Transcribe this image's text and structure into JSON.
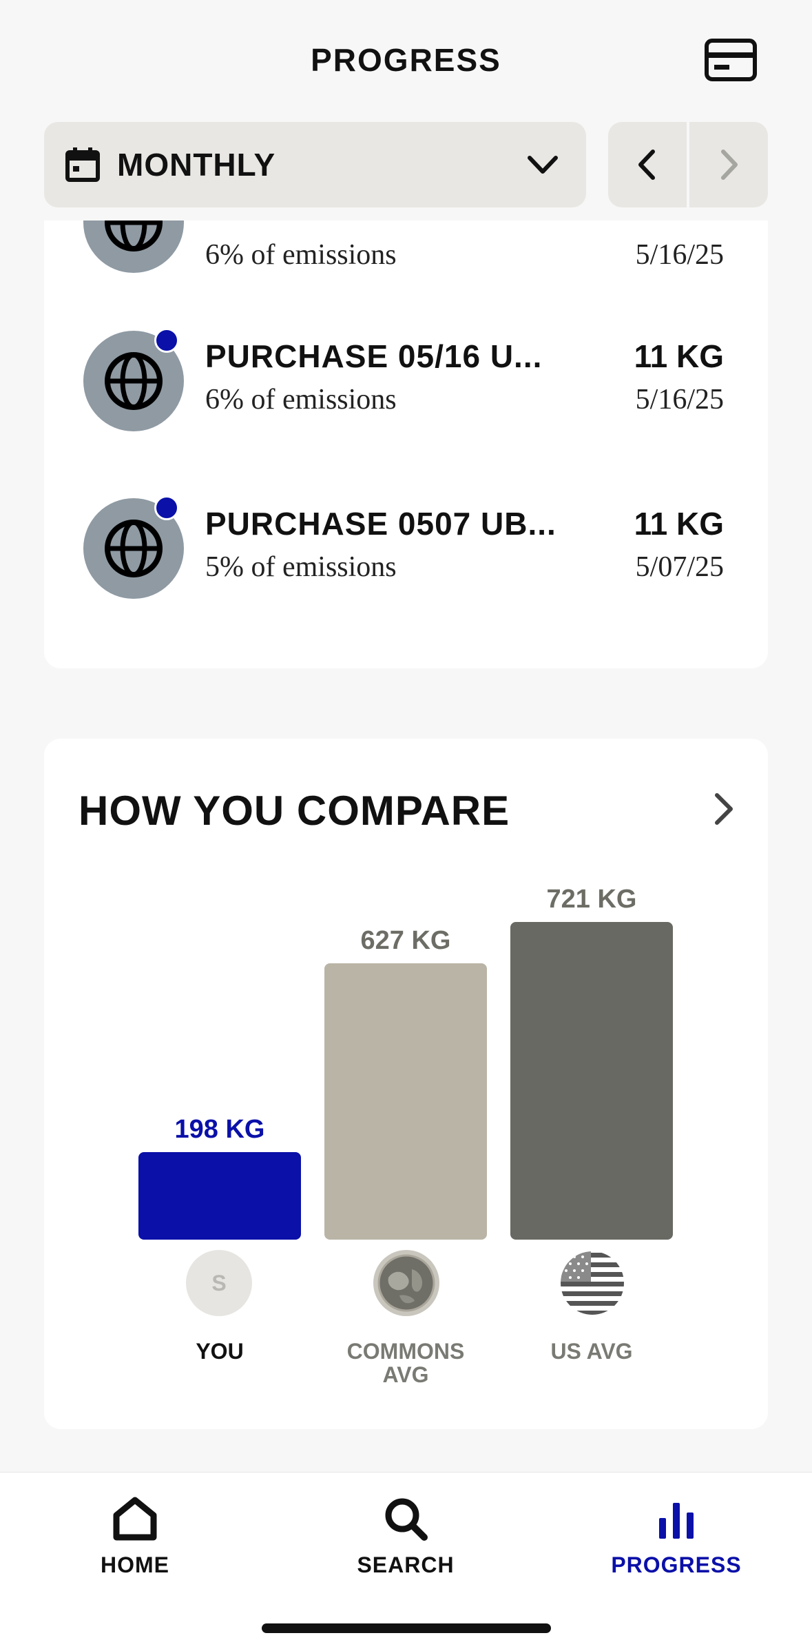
{
  "header": {
    "title": "PROGRESS"
  },
  "filter": {
    "period": "MONTHLY"
  },
  "transactions": [
    {
      "name": "",
      "pct": "6% of emissions",
      "amount": "",
      "date": "5/16/25"
    },
    {
      "name": "PURCHASE 05/16 U...",
      "pct": "6% of emissions",
      "amount": "11 KG",
      "date": "5/16/25"
    },
    {
      "name": "PURCHASE 0507 UB...",
      "pct": "5% of emissions",
      "amount": "11 KG",
      "date": "5/07/25"
    }
  ],
  "compare": {
    "title": "HOW YOU COMPARE",
    "you_initial": "S"
  },
  "chart_data": {
    "type": "bar",
    "categories": [
      "YOU",
      "COMMONS AVG",
      "US AVG"
    ],
    "values": [
      198,
      627,
      721
    ],
    "labels": [
      "198 KG",
      "627 KG",
      "721 KG"
    ],
    "colors": [
      "#0a10a8",
      "#b9b4a6",
      "#686962"
    ],
    "label_colors": [
      "#0a10a8",
      "#6d6d66",
      "#6d6d66"
    ],
    "category_colors": [
      "#111111",
      "#7a7a74",
      "#7a7a74"
    ]
  },
  "nav": {
    "home": "HOME",
    "search": "SEARCH",
    "progress": "PROGRESS",
    "active_color": "#0a10a8"
  }
}
